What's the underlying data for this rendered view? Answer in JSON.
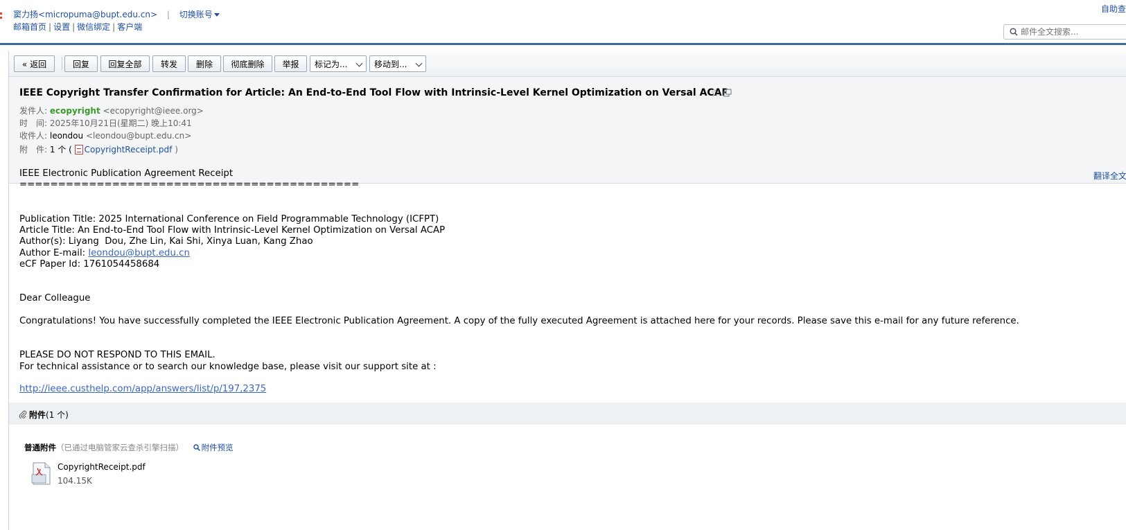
{
  "header": {
    "user_name": "窦力扬",
    "user_email": "<micropuma@bupt.edu.cn>",
    "switch_account": "切换账号",
    "nav": [
      "邮箱首页",
      "设置",
      "微信绑定",
      "客户端"
    ],
    "self_help": "自助查",
    "search_placeholder": "邮件全文搜索..."
  },
  "toolbar": {
    "back": "« 返回",
    "reply": "回复",
    "reply_all": "回复全部",
    "forward": "转发",
    "delete": "删除",
    "delete_permanent": "彻底删除",
    "report": "举报",
    "mark_as": "标记为...",
    "move_to": "移动到..."
  },
  "email": {
    "subject": "IEEE Copyright Transfer Confirmation for Article: An End-to-End Tool Flow with Intrinsic-Level Kernel Optimization on Versal ACAP",
    "from_label": "发件人:",
    "from_name": "ecopyright",
    "from_email": "<ecopyright@ieee.org>",
    "time_label": "时　间:",
    "time_value": "2025年10月21日(星期二) 晚上10:41",
    "to_label": "收件人:",
    "to_name": "leondou",
    "to_email": "<leondou@bupt.edu.cn>",
    "attach_label": "附　件:",
    "attach_count": "1 个 (",
    "attach_file": "CopyrightReceipt.pdf",
    "attach_close": ")",
    "translate": "翻译全文"
  },
  "body": {
    "heading": "IEEE Electronic Publication Agreement Receipt",
    "rule": "============================================",
    "publication_title": "Publication Title: 2025 International Conference on Field Programmable Technology (ICFPT)",
    "article_title": "Article Title: An End-to-End Tool Flow with Intrinsic-Level Kernel Optimization on Versal ACAP",
    "authors": "Author(s): Liyang  Dou, Zhe Lin, Kai Shi, Xinya Luan, Kang Zhao",
    "author_email_label": "Author E-mail: ",
    "author_email": "leondou@bupt.edu.cn",
    "paper_id": "eCF Paper Id: 1761054458684",
    "greeting": "Dear Colleague",
    "congrats": "Congratulations! You have successfully completed the IEEE Electronic Publication Agreement. A copy of the fully executed Agreement is attached here for your records. Please save this e-mail for any future reference.",
    "no_respond": "PLEASE DO NOT RESPOND TO THIS EMAIL.",
    "assist": "For technical assistance or to search our knowledge base, please visit our support site at :",
    "support_url": "http://ieee.custhelp.com/app/answers/list/p/197,2375"
  },
  "attachments": {
    "title": "附件",
    "count": "(1 个)",
    "normal_label": "普通附件",
    "scan_note": "（已通过电脑管家云查杀引擎扫描）",
    "preview": "附件预览",
    "file_name": "CopyrightReceipt.pdf",
    "file_size": "104.15K"
  },
  "colors": {
    "link": "#1e50a2",
    "header_rule": "#3a6aa0",
    "sender_green": "#3a9a2a",
    "head_bg": "#f3f5f7"
  }
}
